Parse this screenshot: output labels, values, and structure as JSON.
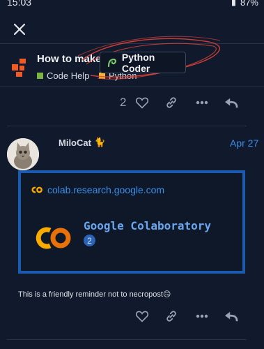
{
  "status_bar": {
    "time": "15:03",
    "battery": "87%"
  },
  "topic": {
    "title": "How to make",
    "categories": [
      {
        "label": "Code Help",
        "color": "#7cb342"
      },
      {
        "label": "Python",
        "color": "#f5b733"
      }
    ]
  },
  "tooltip": {
    "label": "Python Coder",
    "icon": "python-coder-badge-icon"
  },
  "previous_post": {
    "like_count": "2"
  },
  "post": {
    "username": "MiloCat",
    "user_emoji": "🐈",
    "date": "Apr 27",
    "onebox": {
      "domain": "colab.research.google.com",
      "title": "Google Colaboratory",
      "count": "2",
      "logo_text": "CO"
    },
    "text": "This is a friendly reminder not to necropost🙃"
  },
  "colors": {
    "accent": "#3d8ee8",
    "background": "#111a2c",
    "onebox_border": "#1a5bb0",
    "annotation": "#e0433a"
  }
}
